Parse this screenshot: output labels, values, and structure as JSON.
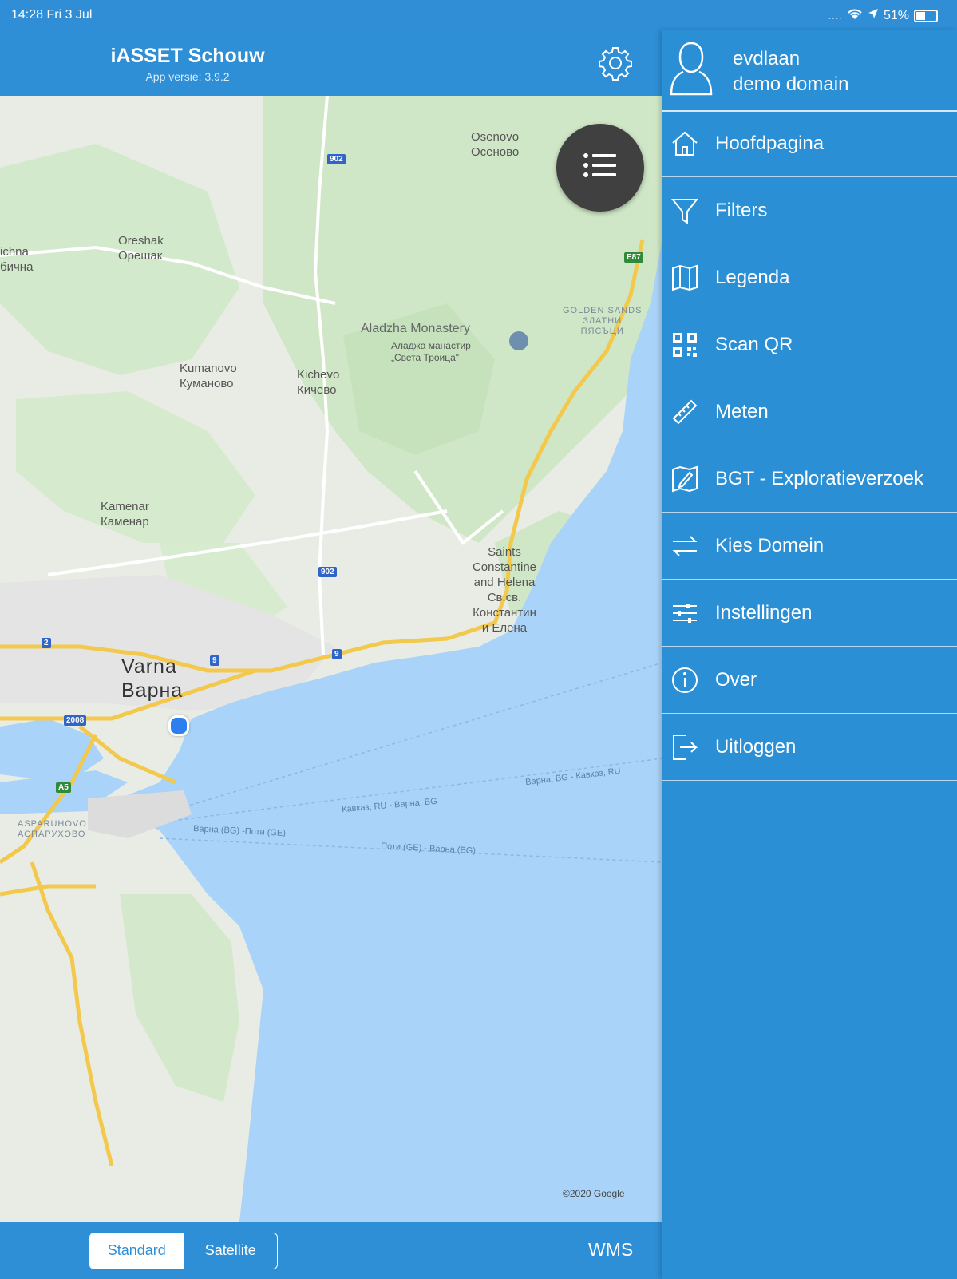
{
  "status": {
    "time": "14:28  Fri 3 Jul",
    "signal": "....",
    "battery": "51%",
    "battery_level": 0.51
  },
  "header": {
    "title": "iASSET Schouw",
    "version": "App versie: 3.9.2"
  },
  "map": {
    "labels": {
      "osenovo_lat": "Osenovo",
      "osenovo_cyr": "Осеново",
      "oreshak_lat": "Oreshak",
      "oreshak_cyr": "Орешак",
      "ichna_lat": "ichna",
      "ichna_cyr": "бична",
      "aladzha_lat": "Aladzha Monastery",
      "aladzha_cyr1": "Аладжа манастир",
      "aladzha_cyr2": "„Света Троица\"",
      "golden_sands": "GOLDEN SANDS",
      "zlatni1": "ЗЛАТНИ",
      "zlatni2": "ПЯСЪЦИ",
      "kumanovo_lat": "Kumanovo",
      "kumanovo_cyr": "Куманово",
      "kichevo_lat": "Kichevo",
      "kichevo_cyr": "Кичево",
      "kamenar_lat": "Kamenar",
      "kamenar_cyr": "Каменар",
      "saints1": "Saints",
      "saints2": "Constantine",
      "saints3": "and Helena",
      "saints4": "Св.св.",
      "saints5": "Константин",
      "saints6": "и Елена",
      "varna_lat": "Varna",
      "varna_cyr": "Варна",
      "asparuhovo_lat": "ASPARUHOVO",
      "asparuhovo_cyr": "АСПАРУХОВО",
      "ferry1": "Кавказ, RU - Варна, BG",
      "ferry2": "Варна, BG - Кавказ, RU",
      "ferry3": "Варна (BG) -Поти (GE)",
      "ferry4": "Поти (GE) - Варна (BG)"
    },
    "shields": {
      "r902a": "902",
      "r902b": "902",
      "e87": "E87",
      "r2": "2",
      "r9a": "9",
      "r9b": "9",
      "r2008": "2008",
      "a5": "A5"
    },
    "copyright": "©2020 Google"
  },
  "bottom": {
    "standard": "Standard",
    "satellite": "Satellite",
    "wms": "WMS"
  },
  "drawer": {
    "user_name": "evdlaan",
    "user_domain": "demo domain",
    "items": [
      {
        "label": "Hoofdpagina",
        "icon": "home-icon"
      },
      {
        "label": "Filters",
        "icon": "filter-icon"
      },
      {
        "label": "Legenda",
        "icon": "map-icon"
      },
      {
        "label": "Scan QR",
        "icon": "qr-icon"
      },
      {
        "label": "Meten",
        "icon": "ruler-icon"
      },
      {
        "label": "BGT - Exploratieverzoek",
        "icon": "edit-map-icon"
      },
      {
        "label": "Kies Domein",
        "icon": "swap-icon"
      },
      {
        "label": "Instellingen",
        "icon": "sliders-icon"
      },
      {
        "label": "Over",
        "icon": "info-icon"
      },
      {
        "label": "Uitloggen",
        "icon": "logout-icon"
      }
    ]
  },
  "colors": {
    "accent": "#2e8ed6",
    "water": "#a9d3f8",
    "land": "#e9ece5",
    "park": "#cbe6c4",
    "road": "#f6d36b"
  }
}
